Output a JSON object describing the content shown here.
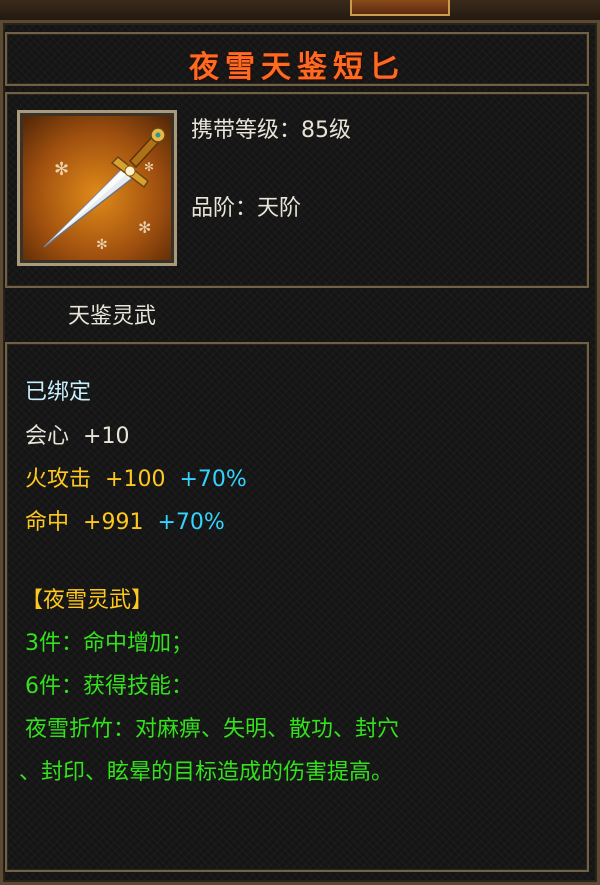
{
  "item": {
    "name": "夜雪天鉴短匕",
    "level_requirement": "携带等级：85级",
    "rank": "品阶：天阶",
    "series": "天鉴灵武"
  },
  "stats": {
    "bound": "已绑定",
    "crit": {
      "label": "会心",
      "value": "+10"
    },
    "fire_attack": {
      "label": "火攻击",
      "value": "+100",
      "bonus": "+70%"
    },
    "accuracy": {
      "label": "命中",
      "value": "+991",
      "bonus": "+70%"
    }
  },
  "set": {
    "name": "【夜雪灵武】",
    "three_piece": "3件：命中增加；",
    "six_piece": "6件：获得技能：",
    "skill_line1": "夜雪折竹：对麻痹、失明、散功、封穴",
    "skill_line2": "、封印、眩晕的目标造成的伤害提高。"
  },
  "icon": "dagger-icon",
  "colors": {
    "title": "#ff6a22",
    "bound": "#c8f0ff",
    "stat": "#e8e4d8",
    "fire_stat": "#ffc81e",
    "bonus": "#34d4ff",
    "set_name": "#ffc81e",
    "set_text": "#33e21c",
    "border": "#6f6148"
  }
}
